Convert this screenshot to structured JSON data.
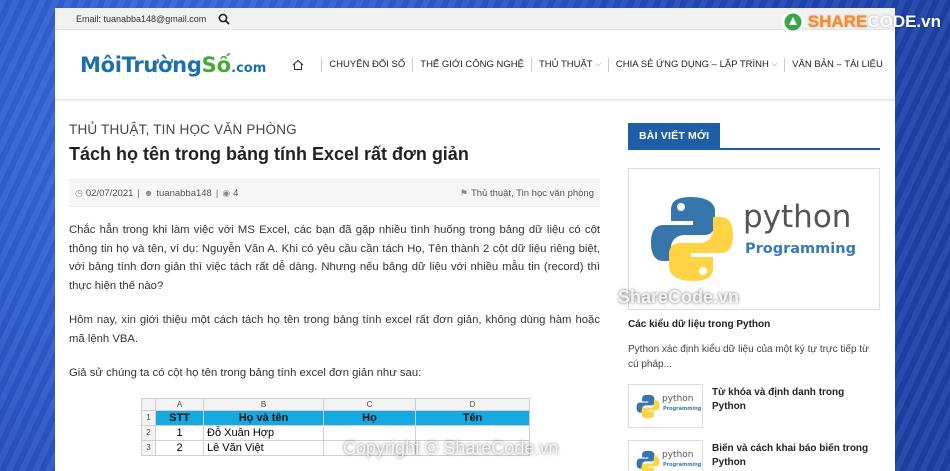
{
  "topbar": {
    "email": "Email: tuanabba148@gmail.com"
  },
  "logo": {
    "part1": "MôiTrường",
    "part2": "Số",
    "part3": ".com"
  },
  "nav": {
    "items": [
      {
        "label": "CHUYỂN ĐỔI SỐ"
      },
      {
        "label": "THẾ GIỚI CÔNG NGHỆ"
      },
      {
        "label": "THỦ THUẬT"
      },
      {
        "label": "CHIA SẺ ỨNG DỤNG – LẬP TRÌNH"
      },
      {
        "label": "VĂN BẢN – TÀI LIỆU"
      }
    ]
  },
  "article": {
    "category": "THỦ THUẬT, TIN HỌC VĂN PHÒNG",
    "title": "Tách họ tên trong bảng tính Excel rất đơn giản",
    "date": "02/07/2021",
    "author": "tuanabba148",
    "views": "4",
    "tags": "Thủ thuật, Tin học văn phòng",
    "para1": "Chắc hẳn trong khi làm việc với MS Excel, các bạn đã gặp nhiều tình huống trong bảng dữ liệu có cột thông tin họ và tên, ví dụ: Nguyễn Văn A. Khi có yêu cầu cần tách Họ, Tên thành 2 cột dữ liệu riêng biệt, với bảng tính đơn giản thì việc tách rất dễ dàng. Nhưng nếu bảng dữ liệu với nhiều mẫu tin (record) thì thực hiện thế nào?",
    "para2": "Hôm nay, xin giới thiệu một cách tách họ tên trong bảng tính excel rất đơn giản, không dùng hàm hoặc mã lệnh VBA.",
    "para3": "Giả sử chúng ta có cột họ tên trong bảng tính excel đơn giản như sau:"
  },
  "excel": {
    "columns": [
      "A",
      "B",
      "C",
      "D"
    ],
    "header": [
      "STT",
      "Họ và tên",
      "Họ",
      "Tên"
    ],
    "rows": [
      {
        "num": "1",
        "stt": "1",
        "name": "Đỗ Xuân Hợp"
      },
      {
        "num": "2",
        "stt": "1",
        "name": "Đỗ Xuân Hợp"
      },
      {
        "num": "3",
        "stt": "2",
        "name": "Lê Văn Việt"
      }
    ],
    "header_color": "#14a9e0"
  },
  "sidebar": {
    "widget_title": "BÀI VIẾT MỚI",
    "feature": {
      "image_text": "python",
      "image_sub": "Programming",
      "title": "Các kiểu dữ liệu trong Python",
      "desc": "Python xác định kiểu dữ liệu của một ký tự trực tiếp từ cú pháp..."
    },
    "posts": [
      {
        "title": "Từ khóa và định danh trong Python",
        "thumb_text": "python",
        "thumb_sub": "Programming"
      },
      {
        "title": "Biến và cách khai báo biến trong Python",
        "thumb_text": "python",
        "thumb_sub": "Programming"
      }
    ]
  },
  "watermarks": {
    "logo_a": "SHARE",
    "logo_b": "CODE.vn",
    "middle": "ShareCode.vn",
    "bottom": "Copyright © ShareCode.vn"
  },
  "colors": {
    "accent": "#1e5ea6",
    "logo_blue": "#1f6fa8",
    "logo_green": "#48a83a"
  }
}
